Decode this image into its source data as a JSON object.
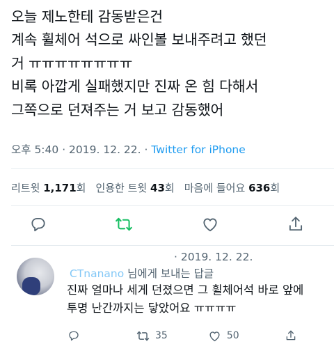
{
  "tweet": {
    "text": "오늘 제노한테 감동받은건\n계속 휠체어 석으로 싸인볼 보내주려고 했던\n거 ㅠㅠㅠㅠㅠㅠㅠㅠ\n비록 아깝게 실패했지만 진짜 온 힘 다해서\n그쪽으로 던져주는 거 보고 감동했어",
    "time": "오후 5:40",
    "separator": " · ",
    "date": "2019. 12. 22.",
    "source": "Twitter for iPhone"
  },
  "stats": {
    "retweets_label": "리트윗",
    "retweets": "1,171",
    "retweets_unit": "회",
    "quotes_label": "인용한 트윗",
    "quotes": "43",
    "quotes_unit": "회",
    "likes_label": "마음에 들어요",
    "likes": "636",
    "likes_unit": "회"
  },
  "actions": {
    "icons": [
      "reply-icon",
      "retweet-icon",
      "like-icon",
      "share-icon"
    ],
    "retweet_color": "#17bf63"
  },
  "reply": {
    "date": "· 2019. 12. 22.",
    "to_user": "CTnanano",
    "to_suffix": " 님에게 보내는 답글",
    "text": "진짜 얼마나 세게 던졌으면 그 휠체어석 바로 앞에\n투명 난간까지는 닿았어요 ㅠㅠㅠㅠ",
    "retweets": "35",
    "likes": "50"
  },
  "colors": {
    "text": "#0f1419",
    "muted": "#536471",
    "link": "#1d9bf0",
    "divider": "#e6ecf0"
  }
}
